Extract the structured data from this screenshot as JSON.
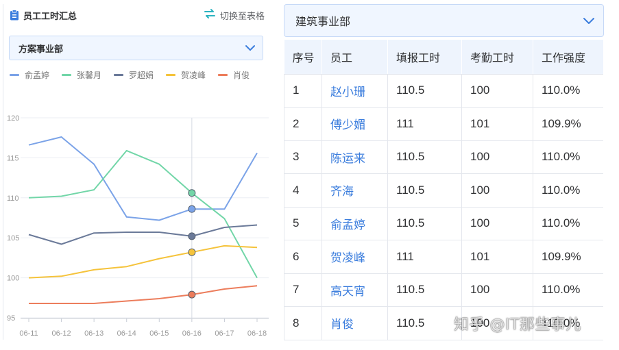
{
  "left_panel": {
    "title": "员工工时汇总",
    "switch_label": "切换至表格",
    "select_value": "方案事业部"
  },
  "legend": [
    {
      "name": "俞孟婷",
      "color": "#7ba3e8"
    },
    {
      "name": "张馨月",
      "color": "#72d6a8"
    },
    {
      "name": "罗超娟",
      "color": "#6b7a99"
    },
    {
      "name": "贺凌峰",
      "color": "#f5c33b"
    },
    {
      "name": "肖俊",
      "color": "#ec7d5c"
    }
  ],
  "chart_data": {
    "type": "line",
    "x": [
      "06-11",
      "06-12",
      "06-13",
      "06-14",
      "06-15",
      "06-16",
      "06-17",
      "06-18"
    ],
    "yticks": [
      95,
      100,
      105,
      110,
      115,
      120
    ],
    "ylim": [
      95,
      120
    ],
    "highlight_x": "06-16",
    "grid": true,
    "series": [
      {
        "name": "俞孟婷",
        "color": "#7ba3e8",
        "values": [
          116.6,
          117.6,
          114.2,
          107.6,
          107.2,
          108.6,
          108.6,
          115.6
        ]
      },
      {
        "name": "张馨月",
        "color": "#72d6a8",
        "values": [
          110.0,
          110.2,
          111.0,
          115.9,
          114.2,
          110.6,
          107.4,
          100.0
        ]
      },
      {
        "name": "罗超娟",
        "color": "#6b7a99",
        "values": [
          105.4,
          104.2,
          105.6,
          105.7,
          105.7,
          105.2,
          106.3,
          106.6
        ]
      },
      {
        "name": "贺凌峰",
        "color": "#f5c33b",
        "values": [
          100.0,
          100.2,
          101.0,
          101.4,
          102.4,
          103.2,
          104.0,
          103.8
        ]
      },
      {
        "name": "肖俊",
        "color": "#ec7d5c",
        "values": [
          96.8,
          96.8,
          96.8,
          97.1,
          97.4,
          97.9,
          98.6,
          99.0
        ]
      }
    ]
  },
  "right_panel": {
    "select_value": "建筑事业部",
    "columns": [
      "序号",
      "员工",
      "填报工时",
      "考勤工时",
      "工作强度"
    ],
    "rows": [
      [
        "1",
        "赵小珊",
        "110.5",
        "100",
        "110.0%"
      ],
      [
        "2",
        "傅少媚",
        "111",
        "101",
        "109.9%"
      ],
      [
        "3",
        "陈运来",
        "110.5",
        "100",
        "110.0%"
      ],
      [
        "4",
        "齐海",
        "110.5",
        "100",
        "110.0%"
      ],
      [
        "5",
        "俞孟婷",
        "110.5",
        "100",
        "110.0%"
      ],
      [
        "6",
        "贺凌峰",
        "111",
        "101",
        "109.9%"
      ],
      [
        "7",
        "高天宵",
        "110.5",
        "100",
        "110.0%"
      ],
      [
        "8",
        "肖俊",
        "110.5",
        "100",
        "110.0%"
      ]
    ]
  },
  "watermark": "知乎 @IT那些事儿"
}
